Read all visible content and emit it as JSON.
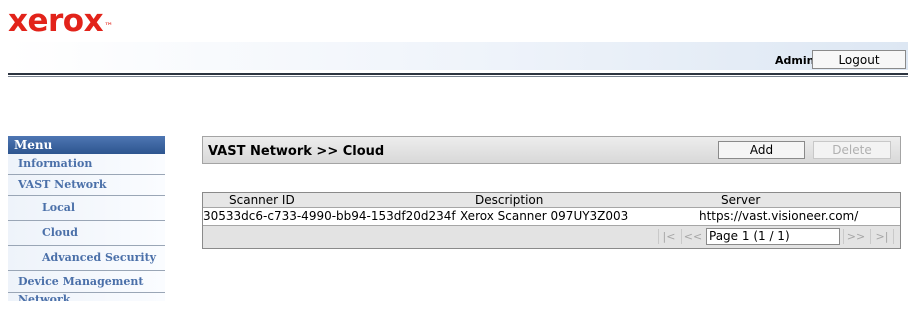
{
  "brand": {
    "logo_text": "xerox",
    "trademark": "™",
    "logo_color": "#e2231a"
  },
  "header": {
    "user": "Admin",
    "logout_label": "Logout"
  },
  "menu": {
    "title": "Menu",
    "items": [
      {
        "label": "Information"
      },
      {
        "label": "VAST Network"
      },
      {
        "label": "Local"
      },
      {
        "label": "Cloud"
      },
      {
        "label": "Advanced Security"
      },
      {
        "label": "Device Management"
      },
      {
        "label": "Network"
      }
    ]
  },
  "panel": {
    "title": "VAST Network >> Cloud",
    "add_label": "Add",
    "delete_label": "Delete"
  },
  "grid": {
    "columns": [
      "Scanner ID",
      "Description",
      "Server"
    ],
    "rows": [
      [
        "30533dc6-c733-4990-bb94-153df20d234f",
        "Xerox  Scanner 097UY3Z003",
        "https://vast.visioneer.com/"
      ]
    ],
    "pager": {
      "first": "|<",
      "prev": "<<",
      "page_text": "Page 1 (1 / 1)",
      "next": ">>",
      "last": ">|"
    }
  },
  "colors": {
    "menu_header": "#2d558f",
    "menu_text": "#4b70a9"
  }
}
